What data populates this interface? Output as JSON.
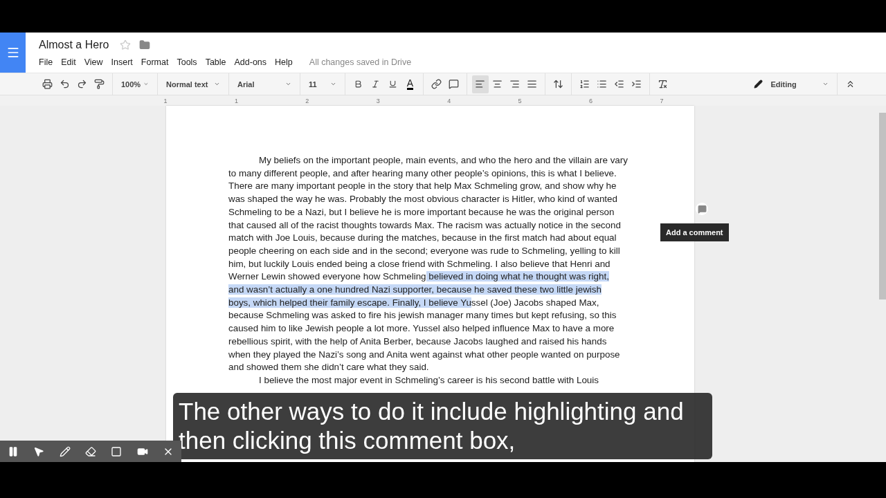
{
  "document": {
    "title": "Almost a Hero",
    "starred": false,
    "save_status": "All changes saved in Drive"
  },
  "menu": [
    "File",
    "Edit",
    "View",
    "Insert",
    "Format",
    "Tools",
    "Table",
    "Add-ons",
    "Help"
  ],
  "toolbar": {
    "zoom": "100%",
    "style": "Normal text",
    "font": "Arial",
    "size": "11",
    "text_color_label": "A",
    "alignment": [
      {
        "kind": "left",
        "selected": true
      },
      {
        "kind": "center",
        "selected": false
      },
      {
        "kind": "right",
        "selected": false
      },
      {
        "kind": "justify",
        "selected": false
      }
    ],
    "mode": "Editing"
  },
  "ruler": [
    "1",
    "1",
    "2",
    "3",
    "4",
    "5",
    "6",
    "7"
  ],
  "paragraphs": [
    {
      "lines": [
        [
          {
            "text": "My beliefs on the important people, main events, and who the hero and the villain are vary",
            "selected": false
          }
        ],
        [
          {
            "text": "to many different people, and after hearing many other people’s opinions, this is what I believe.",
            "selected": false
          }
        ],
        [
          {
            "text": "There are many important people in the story that help Max Schmeling grow, and show why he",
            "selected": false
          }
        ],
        [
          {
            "text": "was shaped the way he was. Probably the most obvious character is Hitler, who kind of wanted",
            "selected": false
          }
        ],
        [
          {
            "text": "Schmeling to be a Nazi, but I believe he is more important because he was the original person",
            "selected": false
          }
        ],
        [
          {
            "text": "that caused all of the racist thoughts towards Max. The racism was actually notice in the second",
            "selected": false
          }
        ],
        [
          {
            "text": "match with Joe Louis, because during the matches, because in the first match had about equal",
            "selected": false
          }
        ],
        [
          {
            "text": "people cheering on each side and in the second; everyone was rude to Schmeling, yelling to kill",
            "selected": false
          }
        ],
        [
          {
            "text": "him, but luckily Louis ended being a close friend with Schmeling. I also believe that Henri and",
            "selected": false
          }
        ],
        [
          {
            "text": "Werner Lewin showed everyone how Schmeling",
            "selected": false
          },
          {
            "text": " believed in doing what he thought was right,",
            "selected": true
          }
        ],
        [
          {
            "text": "and wasn’t actually a one hundred Nazi supporter, because he saved these two little jewish",
            "selected": true
          }
        ],
        [
          {
            "text": "boys, which helped their family escape. Finally, I believe Yu",
            "selected": true
          },
          {
            "text": "ssel (Joe) Jacobs shaped Max,",
            "selected": false
          }
        ],
        [
          {
            "text": "because Schmeling was asked to fire his jewish manager many times but kept refusing, so this",
            "selected": false
          }
        ],
        [
          {
            "text": "caused him to like Jewish people a lot more. Yussel also helped influence Max to have a more",
            "selected": false
          }
        ],
        [
          {
            "text": "rebellious spirit, with the help of Anita Berber, because Jacobs laughed and raised his hands",
            "selected": false
          }
        ],
        [
          {
            "text": "when they played the Nazi’s song and Anita went against what other people wanted on purpose",
            "selected": false
          }
        ],
        [
          {
            "text": "and showed them she didn’t care what they said.",
            "selected": false
          }
        ]
      ]
    },
    {
      "lines": [
        [
          {
            "text": "I believe the most major event in Schmeling’s career is his second battle with Louis",
            "selected": false
          }
        ]
      ]
    }
  ],
  "comment_tooltip": "Add a comment",
  "caption": "The other ways to do it include highlighting and then clicking this comment box,"
}
